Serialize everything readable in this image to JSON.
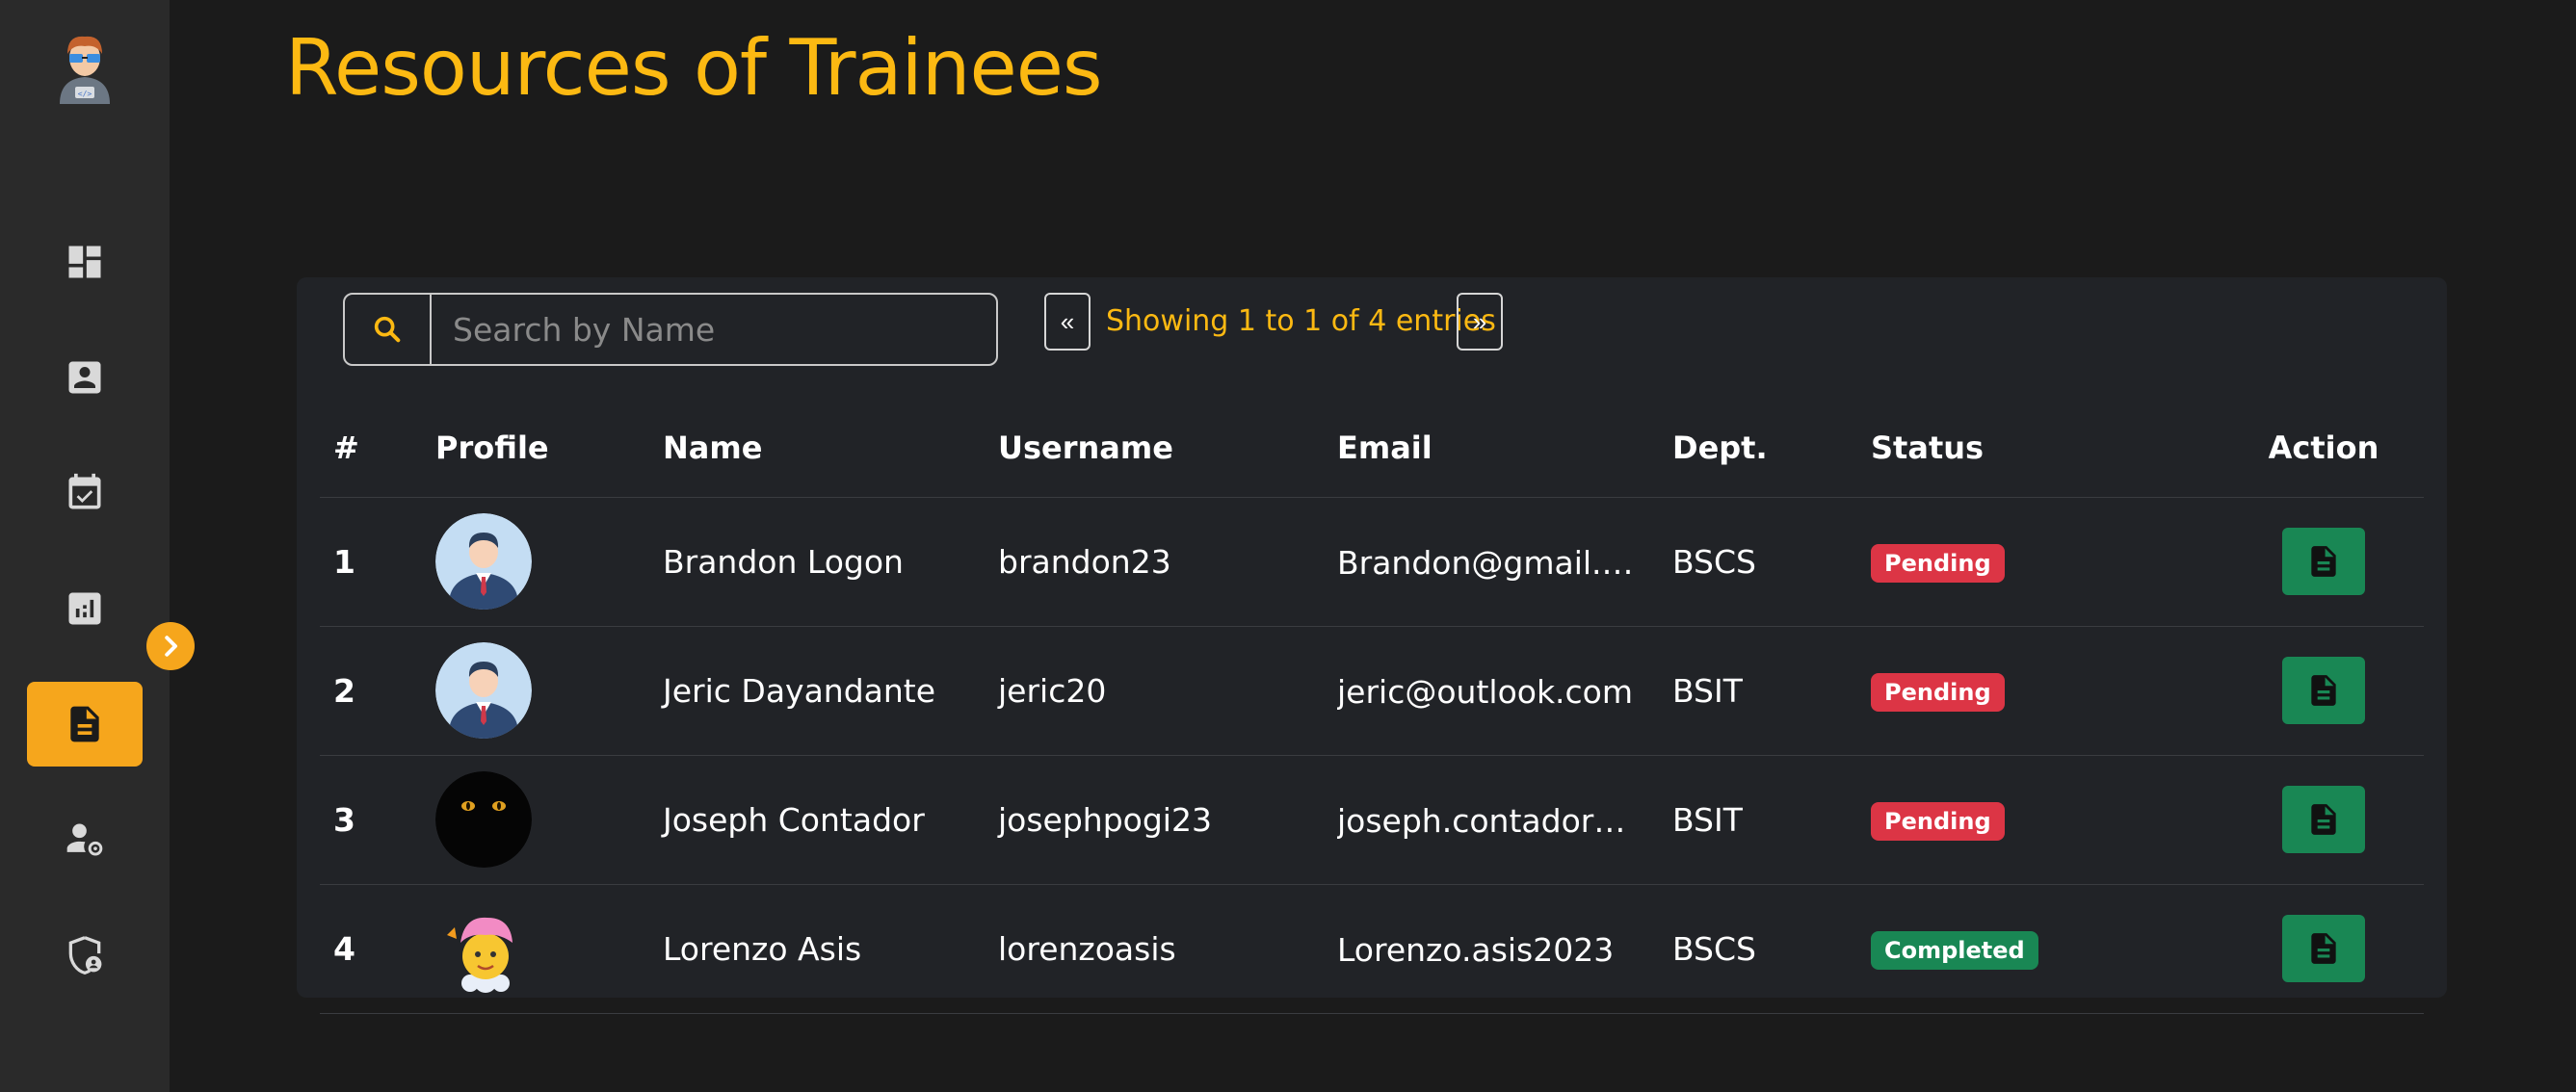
{
  "page": {
    "title": "Resources of Trainees"
  },
  "sidebar": {
    "items": [
      {
        "icon": "dashboard-icon",
        "active": false
      },
      {
        "icon": "profile-icon",
        "active": false
      },
      {
        "icon": "calendar-icon",
        "active": false
      },
      {
        "icon": "chart-icon",
        "active": false
      },
      {
        "icon": "document-icon",
        "active": true
      },
      {
        "icon": "user-settings-icon",
        "active": false
      },
      {
        "icon": "security-icon",
        "active": false
      }
    ]
  },
  "search": {
    "placeholder": "Search by Name",
    "value": ""
  },
  "pagination": {
    "prev": "«",
    "next": "»",
    "status": "Showing 1 to 1 of 4 entries"
  },
  "table": {
    "headers": [
      "#",
      "Profile",
      "Name",
      "Username",
      "Email",
      "Dept.",
      "Status",
      "Action"
    ],
    "rows": [
      {
        "num": "1",
        "avatar": "male-avatar",
        "name": "Brandon Logon",
        "username": "brandon23",
        "email": "Brandon@gmail.c...",
        "dept": "BSCS",
        "status": "Pending"
      },
      {
        "num": "2",
        "avatar": "male-avatar",
        "name": "Jeric Dayandante",
        "username": "jeric20",
        "email": "jeric@outlook.com",
        "dept": "BSIT",
        "status": "Pending"
      },
      {
        "num": "3",
        "avatar": "dark-eyes-avatar",
        "name": "Joseph Contador",
        "username": "josephpogi23",
        "email": "joseph.contador@...",
        "dept": "BSIT",
        "status": "Pending"
      },
      {
        "num": "4",
        "avatar": "emoji-avatar",
        "name": "Lorenzo Asis",
        "username": "lorenzoasis",
        "email": "Lorenzo.asis2023",
        "dept": "BSCS",
        "status": "Completed"
      }
    ]
  },
  "colors": {
    "accent": "#fcb912",
    "pending": "#dc3545",
    "completed": "#198754"
  }
}
